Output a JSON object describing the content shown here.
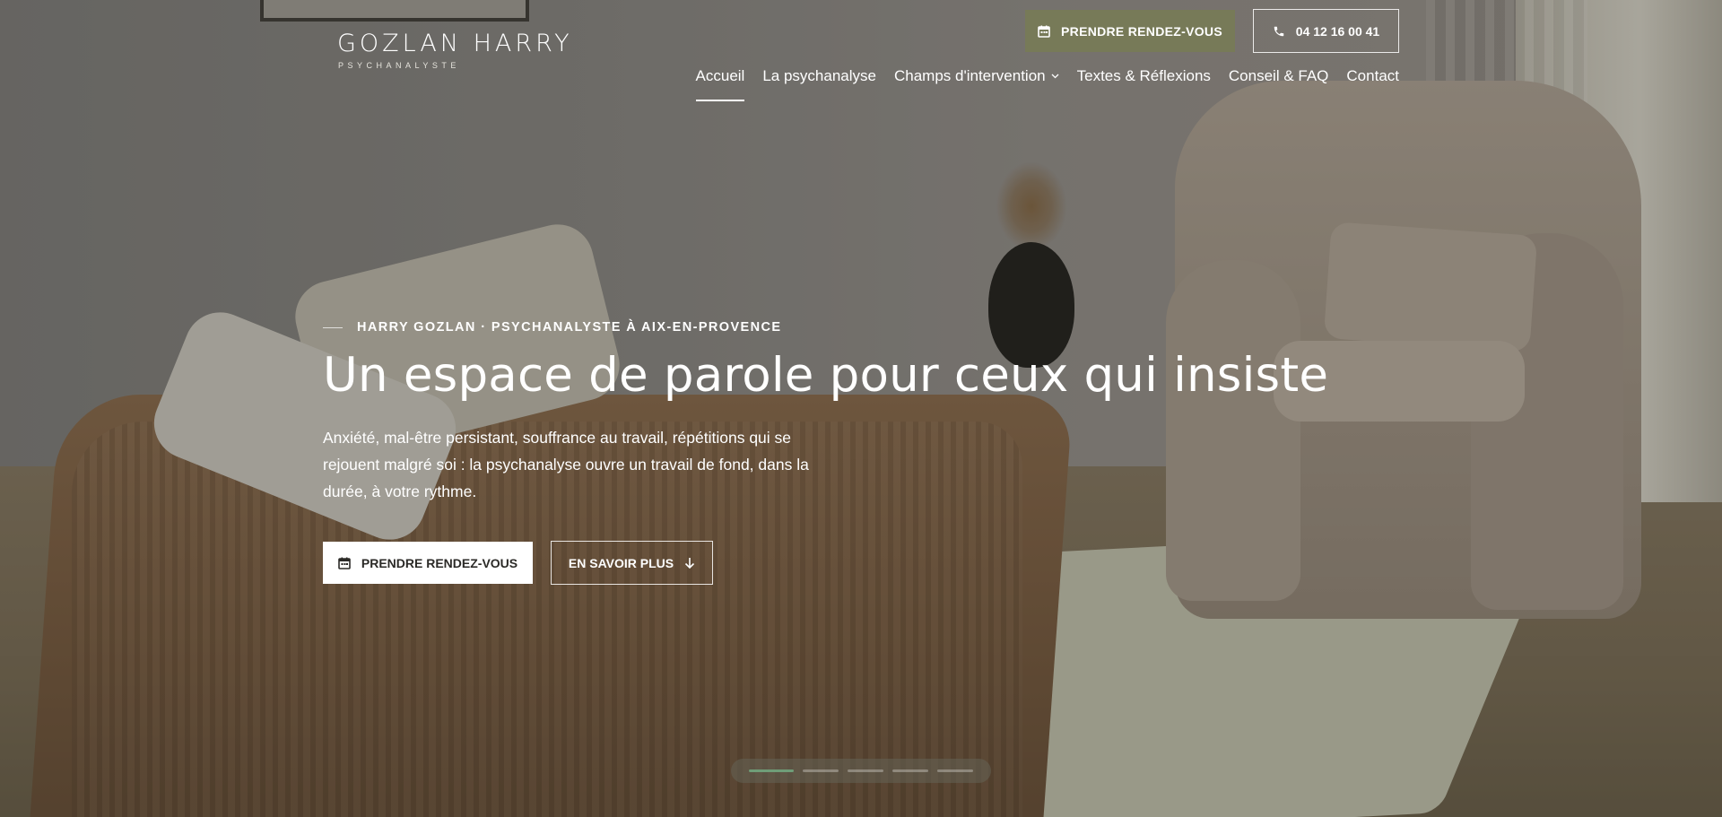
{
  "brand": {
    "name": "GOZLAN HARRY",
    "subtitle": "PSYCHANALYSTE"
  },
  "header": {
    "cta_label": "PRENDRE RENDEZ-VOUS",
    "phone_label": "04 12 16 00 41"
  },
  "nav": {
    "items": [
      {
        "label": "Accueil",
        "active": true
      },
      {
        "label": "La psychanalyse"
      },
      {
        "label": "Champs d'intervention",
        "has_dropdown": true
      },
      {
        "label": "Textes & Réflexions"
      },
      {
        "label": "Conseil & FAQ"
      },
      {
        "label": "Contact"
      }
    ]
  },
  "hero": {
    "eyebrow": "HARRY GOZLAN · PSYCHANALYSTE À AIX-EN-PROVENCE",
    "title": "Un espace de parole pour ceux qui insiste",
    "text": "Anxiété, mal-être persistant, souffrance au travail, répétitions qui se rejouent malgré soi : la psychanalyse ouvre un travail de fond, dans la durée, à votre rythme.",
    "primary_label": "PRENDRE RENDEZ-VOUS",
    "secondary_label": "EN SAVOIR PLUS"
  },
  "slider": {
    "count": 5,
    "active_index": 0
  },
  "colors": {
    "accent_olive": "#777a58",
    "slider_active": "#6f9d78"
  },
  "icons": {
    "calendar": "calendar-icon",
    "phone": "phone-icon",
    "arrow_down": "arrow-down-icon",
    "chevron_down": "chevron-down-icon"
  }
}
